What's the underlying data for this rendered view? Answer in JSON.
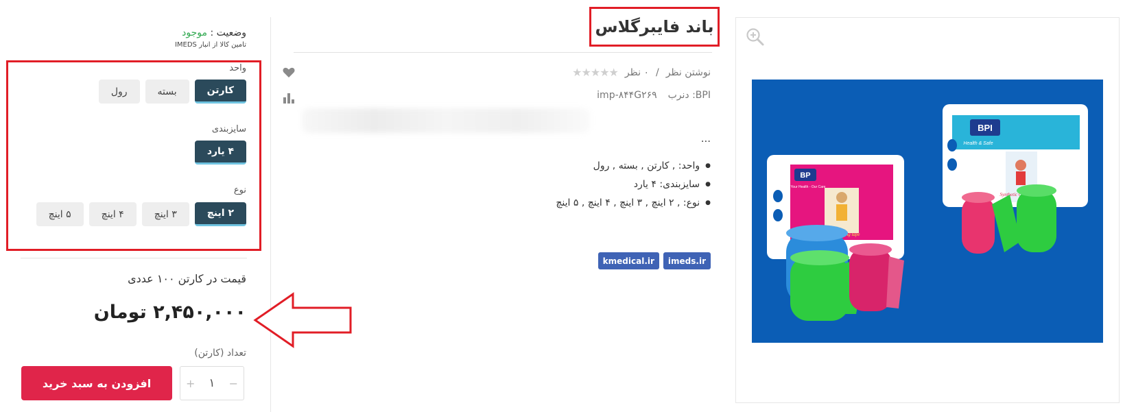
{
  "purchase": {
    "status_label": "وضعیت :",
    "status_value": "موجود",
    "supply_note": "تامین کالا از انبار IMEDS",
    "option_groups": [
      {
        "label": "واحد",
        "options": [
          "کارتن",
          "بسته",
          "رول"
        ],
        "selected": "کارتن"
      },
      {
        "label": "سایزبندی",
        "options": [
          "۴ یارد"
        ],
        "selected": "۴ یارد"
      },
      {
        "label": "نوع",
        "options": [
          "۲ اینچ",
          "۳ اینچ",
          "۴ اینچ",
          "۵ اینچ"
        ],
        "selected": "۲ اینچ"
      }
    ],
    "price_label": "قیمت در کارتن ۱۰۰ عددی",
    "price": "۲,۴۵۰,۰۰۰ تومان",
    "quantity_label": "تعداد (کارتن)",
    "quantity": "۱",
    "minus": "−",
    "plus": "+",
    "add_to_cart": "افزودن به سبد خرید"
  },
  "product": {
    "title": "باند فایبرگلاس",
    "stars": "★★★★★",
    "reviews_count": "۰ نظر",
    "separator": "/",
    "write_review": "نوشتن نظر",
    "brand_label": "برند :BPI",
    "sku": "imp-۸۴۴G۲۶۹",
    "ellipsis": "...",
    "specs": [
      "واحد: , کارتن , بسته , رول",
      "سایزبندی: ۴ یارد",
      "نوع: , ۲ اینچ , ۳ اینچ , ۴ اینچ , ۵ اینچ"
    ],
    "tags": [
      "imeds.ir",
      "kmedical.ir"
    ]
  },
  "image": {
    "box_a_brand": "BPI",
    "box_a_subtitle": "Health & Safe",
    "box_a_product": "Synthetic Casting tape",
    "box_b_brand": "BP",
    "box_b_subtitle": "Your Health - Our Care",
    "box_b_product": "Synthetic Casting tape"
  },
  "colors": {
    "accent_dark": "#2b4a5b",
    "cart_red": "#e0254a",
    "annotation_red": "#e11d26",
    "tag_blue": "#3f63b5",
    "in_stock_green": "#2fa84f",
    "image_bg": "#0b5db5"
  },
  "icons": [
    "heart-icon",
    "compare-chart-icon",
    "zoom-in-icon",
    "star-icon"
  ]
}
